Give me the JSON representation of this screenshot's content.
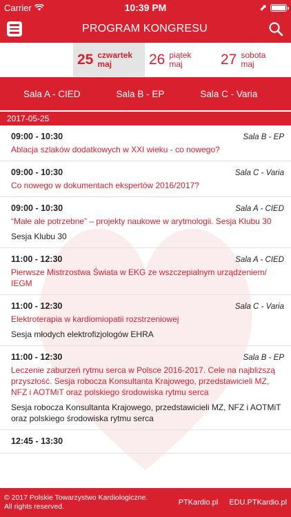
{
  "status_bar": {
    "carrier": "Carrier",
    "time": "10:39 PM"
  },
  "header": {
    "title": "PROGRAM KONGRESU"
  },
  "date_tabs": [
    {
      "num": "25",
      "day": "czwartek",
      "month": "maj"
    },
    {
      "num": "26",
      "day": "piątek",
      "month": "maj"
    },
    {
      "num": "27",
      "day": "sobota",
      "month": "maj"
    }
  ],
  "hall_tabs": [
    "Sala A - CIED",
    "Sala B - EP",
    "Sala C - Varia"
  ],
  "day_header": "2017-05-25",
  "sessions": [
    {
      "time": "09:00 - 10:30",
      "hall": "Sala B - EP",
      "title": "Ablacja szlaków dodatkowych w XXI wieku - co nowego?",
      "sub": ""
    },
    {
      "time": "09:00 - 10:30",
      "hall": "Sala C - Varia",
      "title": "Co nowego w  dokumentach ekspertów 2016/2017?",
      "sub": ""
    },
    {
      "time": "09:00 - 10:30",
      "hall": "Sala A - CIED",
      "title": "“Małe ale potrzebne” – projekty naukowe w arytmologii. Sesja Klubu 30",
      "sub": "Sesja Klubu 30"
    },
    {
      "time": "11:00 - 12:30",
      "hall": "Sala A - CIED",
      "title": "Pierwsze Mistrzostwa Świata w EKG ze wszczepialnym urządzeniem/ IEGM",
      "sub": ""
    },
    {
      "time": "11:00 - 12:30",
      "hall": "Sala C - Varia",
      "title": "Elektroterapia w kardiomiopatii rozstrzeniowej",
      "sub": "Sesja młodych elektrofizjologów EHRA"
    },
    {
      "time": "11:00 - 12:30",
      "hall": "Sala B - EP",
      "title": "Leczenie zaburzeń rytmu serca w Polsce 2016-2017. Cele na najbliższą przyszłość. Sesja robocza Konsultanta Krajowego, przedstawicieli MZ, NFZ i AOTMiT oraz polskiego środowiska rytmu serca",
      "sub": "Sesja robocza Konsultanta Krajowego, przedstawicieli MZ, NFZ i AOTMiT oraz polskiego środowiska rytmu serca"
    },
    {
      "time": "12:45 - 13:30",
      "hall": "",
      "title": "",
      "sub": ""
    }
  ],
  "footer": {
    "copyright_line1": "© 2017 Polskie Towarzystwo Kardiologiczne.",
    "copyright_line2": "All rights reserved.",
    "link1": "PTKardio.pl",
    "link2": "EDU.PTKardio.pl"
  },
  "colors": {
    "brand_red": "#d8202f",
    "active_tab_bg": "#e4e4e4"
  }
}
